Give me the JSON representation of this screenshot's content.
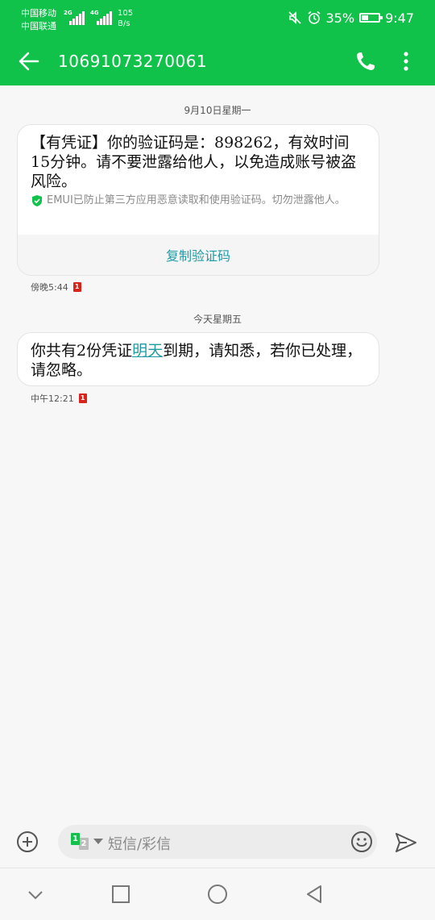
{
  "status_bar": {
    "carrier_1": "中国移动",
    "carrier_2": "中国联通",
    "network_1": "2G",
    "network_2": "4G",
    "speed_value": "105",
    "speed_unit": "B/s",
    "battery_percent": "35%",
    "battery_level": 0.35,
    "time": "9:47",
    "icons": [
      "mute-icon",
      "alarm-icon",
      "battery-icon"
    ]
  },
  "header": {
    "title": "10691073270061",
    "color": "#10c14a"
  },
  "conversation": {
    "date_1": "9月10日星期一",
    "message_1": {
      "text": "【有凭证】你的验证码是：898262，有效时间15分钟。请不要泄露给他人，以免造成账号被盗风险。",
      "security_notice": "EMUI已防止第三方应用恶意读取和使用验证码。切勿泄露他人。",
      "copy_button": "复制验证码",
      "time": "傍晚5:44",
      "sim": "1"
    },
    "date_2": "今天星期五",
    "message_2": {
      "text_before_link": "你共有2份凭证",
      "link_text": "明天",
      "text_after_link": "到期，请知悉，若你已处理，请忽略。",
      "time": "中午12:21",
      "sim": "1"
    }
  },
  "composer": {
    "sim_primary": "1",
    "sim_secondary": "2",
    "placeholder": "短信/彩信"
  },
  "colors": {
    "accent": "#10c14a",
    "link": "#1e9ca6",
    "sim_badge": "#d9241c"
  }
}
